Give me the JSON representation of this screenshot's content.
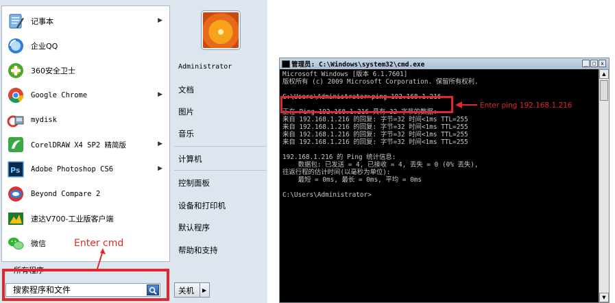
{
  "start_menu": {
    "programs": [
      {
        "label": "记事本",
        "icon": "notepad-icon",
        "arrow": true
      },
      {
        "label": "企业QQ",
        "icon": "qq-icon",
        "arrow": false
      },
      {
        "label": "360安全卫士",
        "icon": "360-safe-icon",
        "arrow": false
      },
      {
        "label": "Google Chrome",
        "icon": "chrome-icon",
        "arrow": true
      },
      {
        "label": "mydisk",
        "icon": "mydisk-icon",
        "arrow": false
      },
      {
        "label": "CorelDRAW X4 SP2 精简版",
        "icon": "coreldraw-icon",
        "arrow": true
      },
      {
        "label": "Adobe Photoshop CS6",
        "icon": "photoshop-icon",
        "arrow": true
      },
      {
        "label": "Beyond Compare 2",
        "icon": "beyond-compare-icon",
        "arrow": false
      },
      {
        "label": "速达V700-工业版客户端",
        "icon": "suda-icon",
        "arrow": false
      },
      {
        "label": "微信",
        "icon": "wechat-icon",
        "arrow": false
      }
    ],
    "all_programs": "所有程序",
    "search_placeholder": "搜索程序和文件",
    "right_items": [
      "Administrator",
      "文档",
      "图片",
      "音乐",
      "计算机",
      "控制面板",
      "设备和打印机",
      "默认程序",
      "帮助和支持"
    ],
    "shutdown_label": "关机",
    "shutdown_arrow": "▶"
  },
  "annotations": {
    "enter_cmd": "Enter cmd",
    "enter_ping": "Enter ping 192.168.1.216"
  },
  "cmd": {
    "title": "管理员: C:\\Windows\\system32\\cmd.exe",
    "minimize": "_",
    "maximize": "□",
    "close": "x",
    "lines": [
      "Microsoft Windows [版本 6.1.7601]",
      "版权所有 (c) 2009 Microsoft Corporation. 保留所有权利.",
      "",
      "C:\\Users\\Administrator>ping 192.168.1.216",
      "",
      "正在 Ping 192.168.1.216 具有 32 字节的数据:",
      "来自 192.168.1.216 的回复: 字节=32 时间<1ms TTL=255",
      "来自 192.168.1.216 的回复: 字节=32 时间<1ms TTL=255",
      "来自 192.168.1.216 的回复: 字节=32 时间<1ms TTL=255",
      "来自 192.168.1.216 的回复: 字节=32 时间<1ms TTL=255",
      "",
      "192.168.1.216 的 Ping 统计信息:",
      "    数据包: 已发送 = 4, 已接收 = 4, 丢失 = 0 (0% 丢失),",
      "往返行程的估计时间(以毫秒为单位):",
      "    最短 = 0ms, 最长 = 0ms, 平均 = 0ms",
      "",
      "C:\\Users\\Administrator>"
    ]
  },
  "colors": {
    "annotation_red": "#e3262b",
    "cmd_background": "#000000",
    "cmd_text": "#c8c8c8"
  }
}
